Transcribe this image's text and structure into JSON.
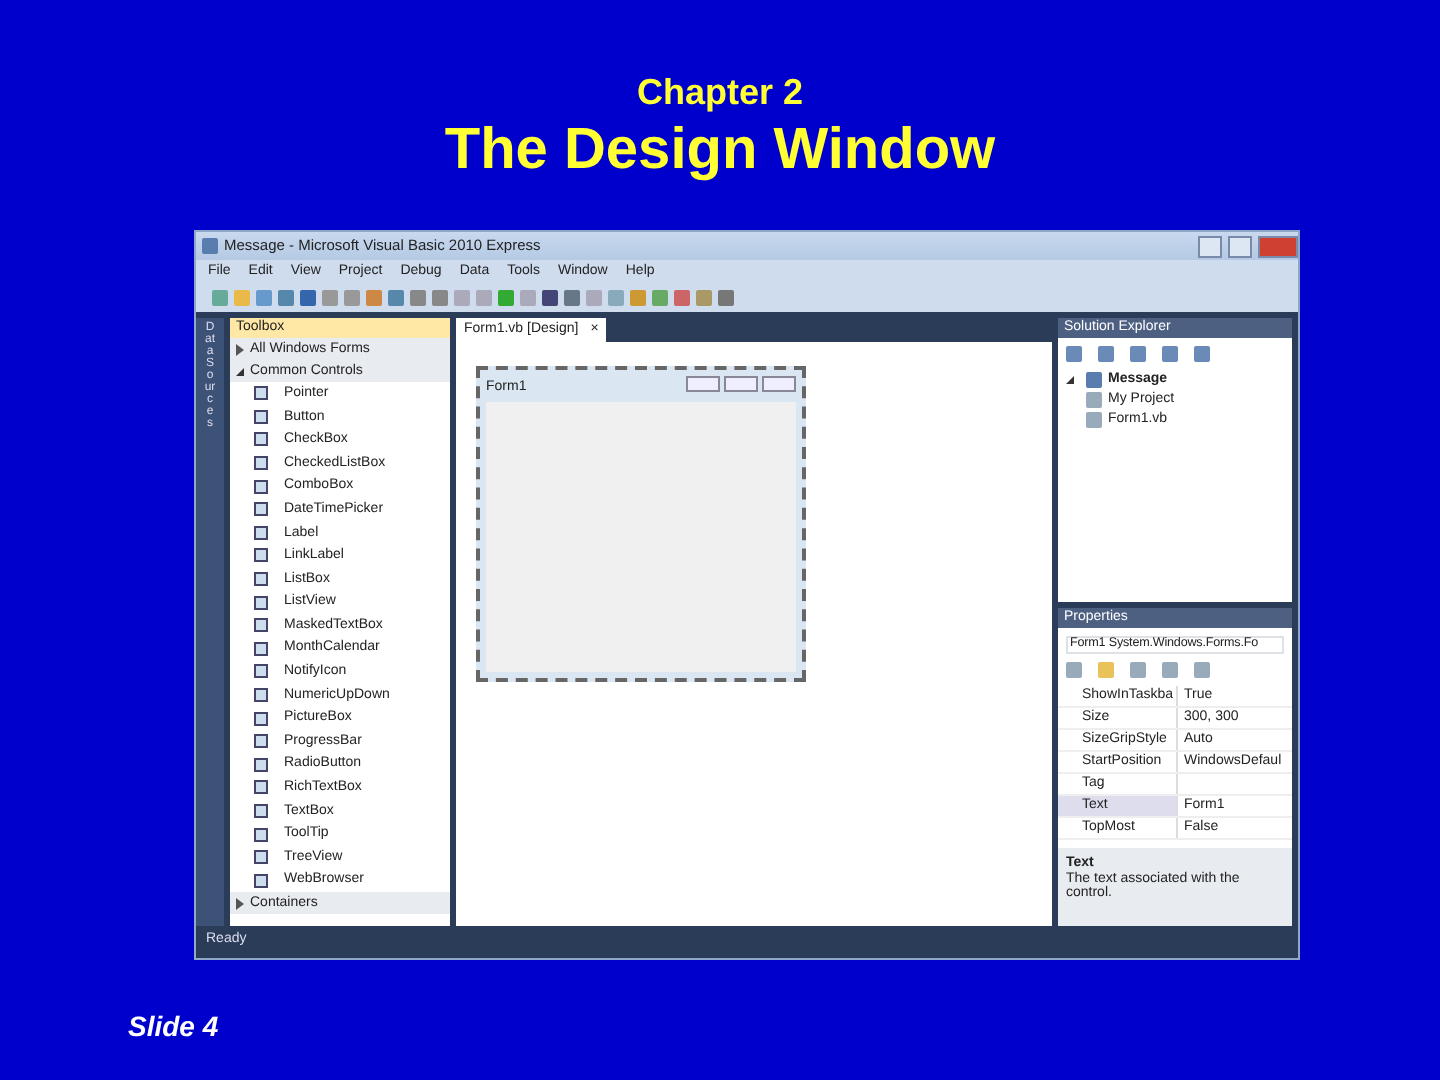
{
  "slide": {
    "chapter": "Chapter 2",
    "title": "The Design Window",
    "footer": "Slide 4"
  },
  "window": {
    "title": "Message - Microsoft Visual Basic 2010 Express",
    "menu": [
      "File",
      "Edit",
      "View",
      "Project",
      "Debug",
      "Data",
      "Tools",
      "Window",
      "Help"
    ],
    "side_tab": "Data Sources",
    "toolbox": {
      "title": "Toolbox",
      "sections": [
        {
          "label": "All Windows Forms",
          "expanded": false
        },
        {
          "label": "Common Controls",
          "expanded": true,
          "items": [
            "Pointer",
            "Button",
            "CheckBox",
            "CheckedListBox",
            "ComboBox",
            "DateTimePicker",
            "Label",
            "LinkLabel",
            "ListBox",
            "ListView",
            "MaskedTextBox",
            "MonthCalendar",
            "NotifyIcon",
            "NumericUpDown",
            "PictureBox",
            "ProgressBar",
            "RadioButton",
            "RichTextBox",
            "TextBox",
            "ToolTip",
            "TreeView",
            "WebBrowser"
          ]
        },
        {
          "label": "Containers",
          "expanded": false
        }
      ]
    },
    "document_tab": {
      "label": "Form1.vb [Design]",
      "close": "×"
    },
    "form": {
      "title": "Form1"
    },
    "solution_explorer": {
      "title": "Solution Explorer",
      "tree": [
        {
          "label": "Message",
          "expanded": true,
          "children": [
            {
              "label": "My Project"
            },
            {
              "label": "Form1.vb"
            }
          ]
        }
      ]
    },
    "properties": {
      "title": "Properties",
      "object": "Form1 System.Windows.Forms.Fo",
      "rows": [
        {
          "name": "ShowInTaskba",
          "value": "True",
          "selected": false
        },
        {
          "name": "Size",
          "value": "300, 300",
          "selected": false
        },
        {
          "name": "SizeGripStyle",
          "value": "Auto",
          "selected": false
        },
        {
          "name": "StartPosition",
          "value": "WindowsDefaul",
          "selected": false
        },
        {
          "name": "Tag",
          "value": "",
          "selected": false
        },
        {
          "name": "Text",
          "value": "Form1",
          "selected": true
        },
        {
          "name": "TopMost",
          "value": "False",
          "selected": false
        }
      ],
      "description_title": "Text",
      "description": "The text associated with the control."
    },
    "status_bar": "Ready"
  }
}
